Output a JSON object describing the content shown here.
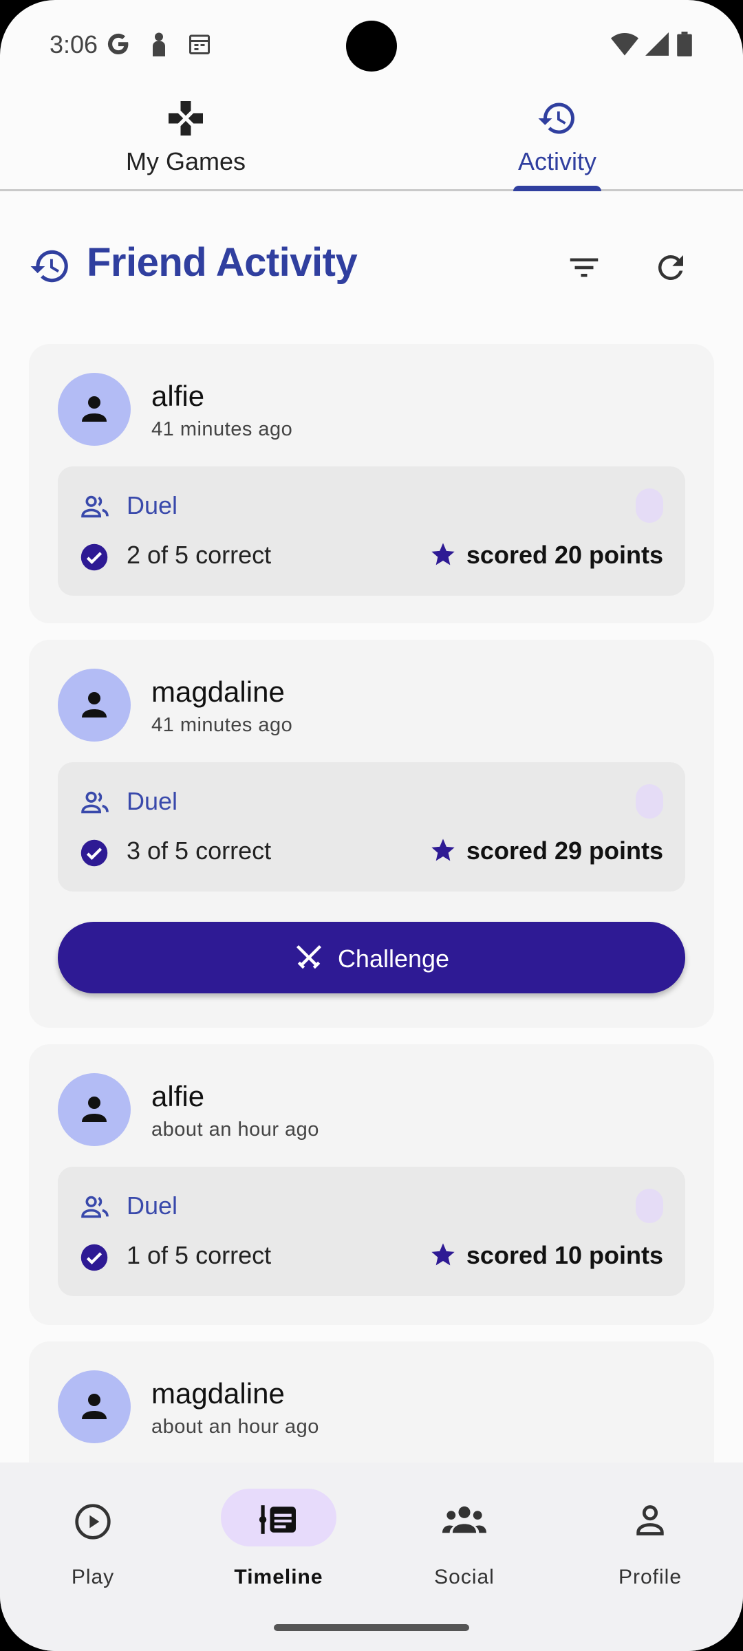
{
  "status_bar": {
    "time": "3:06",
    "icons": [
      "google-icon",
      "person-icon",
      "calendar-icon",
      "wifi-icon",
      "signal-icon",
      "battery-icon"
    ]
  },
  "top_tabs": [
    {
      "label": "My Games",
      "icon": "gamepad-icon",
      "active": false
    },
    {
      "label": "Activity",
      "icon": "history-icon",
      "active": true
    }
  ],
  "header": {
    "title": "Friend Activity",
    "icons": [
      "history-icon",
      "filter-icon",
      "refresh-icon"
    ]
  },
  "feed": [
    {
      "user": "alfie",
      "time": "41 minutes ago",
      "game_type": "Duel",
      "correct": "2 of 5 correct",
      "score": "scored 20 points",
      "challenge": false
    },
    {
      "user": "magdaline",
      "time": "41 minutes ago",
      "game_type": "Duel",
      "correct": "3 of 5 correct",
      "score": "scored 29 points",
      "challenge": true,
      "challenge_label": "Challenge"
    },
    {
      "user": "alfie",
      "time": "about an hour ago",
      "game_type": "Duel",
      "correct": "1 of 5 correct",
      "score": "scored 10 points",
      "challenge": false
    },
    {
      "user": "magdaline",
      "time": "about an hour ago"
    }
  ],
  "bottom_nav": [
    {
      "label": "Play",
      "icon": "play-circle-icon",
      "active": false
    },
    {
      "label": "Timeline",
      "icon": "timeline-icon",
      "active": true
    },
    {
      "label": "Social",
      "icon": "group-icon",
      "active": false
    },
    {
      "label": "Profile",
      "icon": "person-outline-icon",
      "active": false
    }
  ],
  "colors": {
    "primary": "#303f9f",
    "button": "#2e1a94",
    "avatar_bg": "#b3bcf5",
    "active_pill": "#e7dbfb"
  }
}
